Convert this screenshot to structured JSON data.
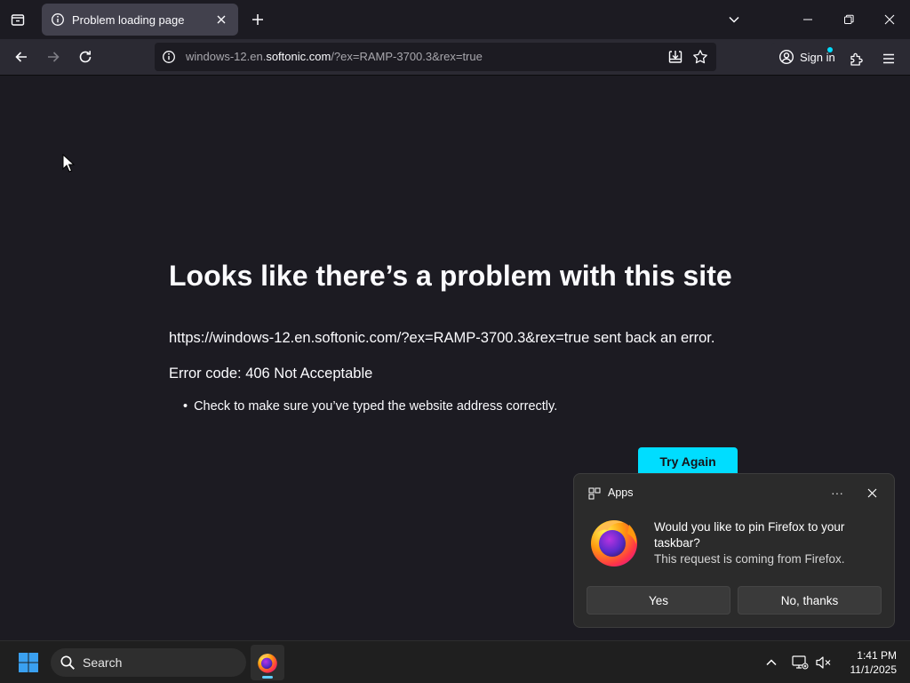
{
  "browser": {
    "tab": {
      "title": "Problem loading page"
    },
    "url": {
      "prefix": "windows-12.en.",
      "domain": "softonic.com",
      "suffix": "/?ex=RAMP-3700.3&rex=true"
    },
    "signin_label": "Sign in"
  },
  "error_page": {
    "title": "Looks like there’s a problem with this site",
    "description": "https://windows-12.en.softonic.com/?ex=RAMP-3700.3&rex=true sent back an error.",
    "error_code": "Error code: 406 Not Acceptable",
    "tips": [
      "Check to make sure you’ve typed the website address correctly."
    ],
    "try_again_label": "Try Again"
  },
  "toast": {
    "app_name": "Apps",
    "more_label": "···",
    "message": "Would you like to pin Firefox to your taskbar?",
    "sub_message": "This request is coming from Firefox.",
    "yes_label": "Yes",
    "no_label": "No, thanks"
  },
  "taskbar": {
    "search_label": "Search",
    "time": "1:41 PM",
    "date": "11/1/2025"
  },
  "colors": {
    "accent": "#00ddff",
    "content_bg": "#1c1b22",
    "toolbar_bg": "#2b2a33",
    "tab_active_bg": "#42414d"
  }
}
